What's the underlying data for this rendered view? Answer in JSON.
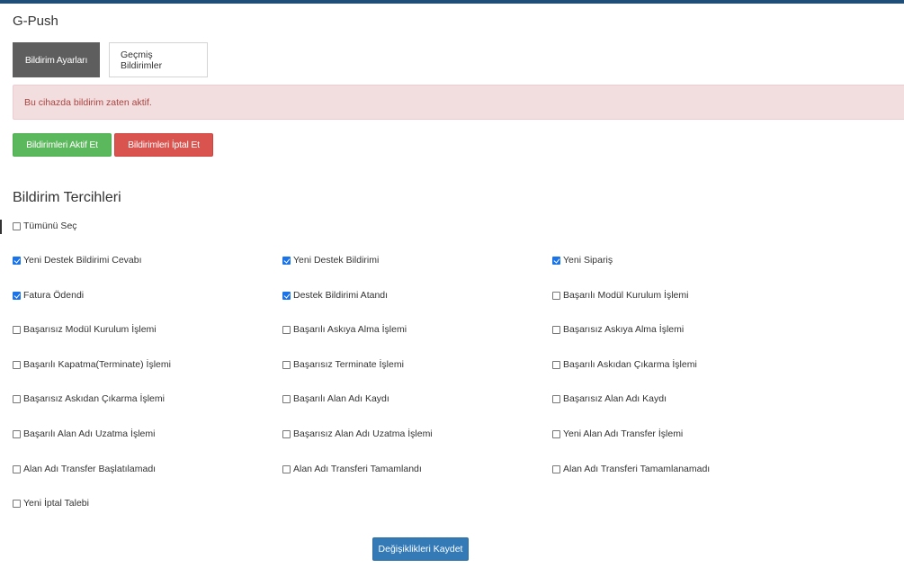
{
  "page": {
    "title": "G-Push"
  },
  "tabs": [
    {
      "label": "Bildirim Ayarları",
      "active": true
    },
    {
      "label": "Geçmiş Bildirimler",
      "active": false
    }
  ],
  "alert": {
    "text": "Bu cihazda bildirim zaten aktif."
  },
  "actions": {
    "enable_label": "Bildirimleri Aktif Et",
    "disable_label": "Bildirimleri İptal Et"
  },
  "preferences": {
    "title": "Bildirim Tercihleri",
    "select_all": {
      "label": "Tümünü Seç",
      "checked": false
    },
    "items": [
      {
        "label": "Yeni Destek Bildirimi Cevabı",
        "checked": true
      },
      {
        "label": "Yeni Destek Bildirimi",
        "checked": true
      },
      {
        "label": "Yeni Sipariş",
        "checked": true
      },
      {
        "label": "Fatura Ödendi",
        "checked": true
      },
      {
        "label": "Destek Bildirimi Atandı",
        "checked": true
      },
      {
        "label": "Başarılı Modül Kurulum İşlemi",
        "checked": false
      },
      {
        "label": "Başarısız Modül Kurulum İşlemi",
        "checked": false
      },
      {
        "label": "Başarılı Askıya Alma İşlemi",
        "checked": false
      },
      {
        "label": "Başarısız Askıya Alma İşlemi",
        "checked": false
      },
      {
        "label": "Başarılı Kapatma(Terminate) İşlemi",
        "checked": false
      },
      {
        "label": "Başarısız Terminate İşlemi",
        "checked": false
      },
      {
        "label": "Başarılı Askıdan Çıkarma İşlemi",
        "checked": false
      },
      {
        "label": "Başarısız Askıdan Çıkarma İşlemi",
        "checked": false
      },
      {
        "label": "Başarılı Alan Adı Kaydı",
        "checked": false
      },
      {
        "label": "Başarısız Alan Adı Kaydı",
        "checked": false
      },
      {
        "label": "Başarılı Alan Adı Uzatma İşlemi",
        "checked": false
      },
      {
        "label": "Başarısız Alan Adı Uzatma İşlemi",
        "checked": false
      },
      {
        "label": "Yeni Alan Adı Transfer İşlemi",
        "checked": false
      },
      {
        "label": "Alan Adı Transfer Başlatılamadı",
        "checked": false
      },
      {
        "label": "Alan Adı Transferi Tamamlandı",
        "checked": false
      },
      {
        "label": "Alan Adı Transferi Tamamlanamadı",
        "checked": false
      },
      {
        "label": "Yeni İptal Talebi",
        "checked": false
      }
    ]
  },
  "save": {
    "label": "Değişiklikleri Kaydet"
  }
}
